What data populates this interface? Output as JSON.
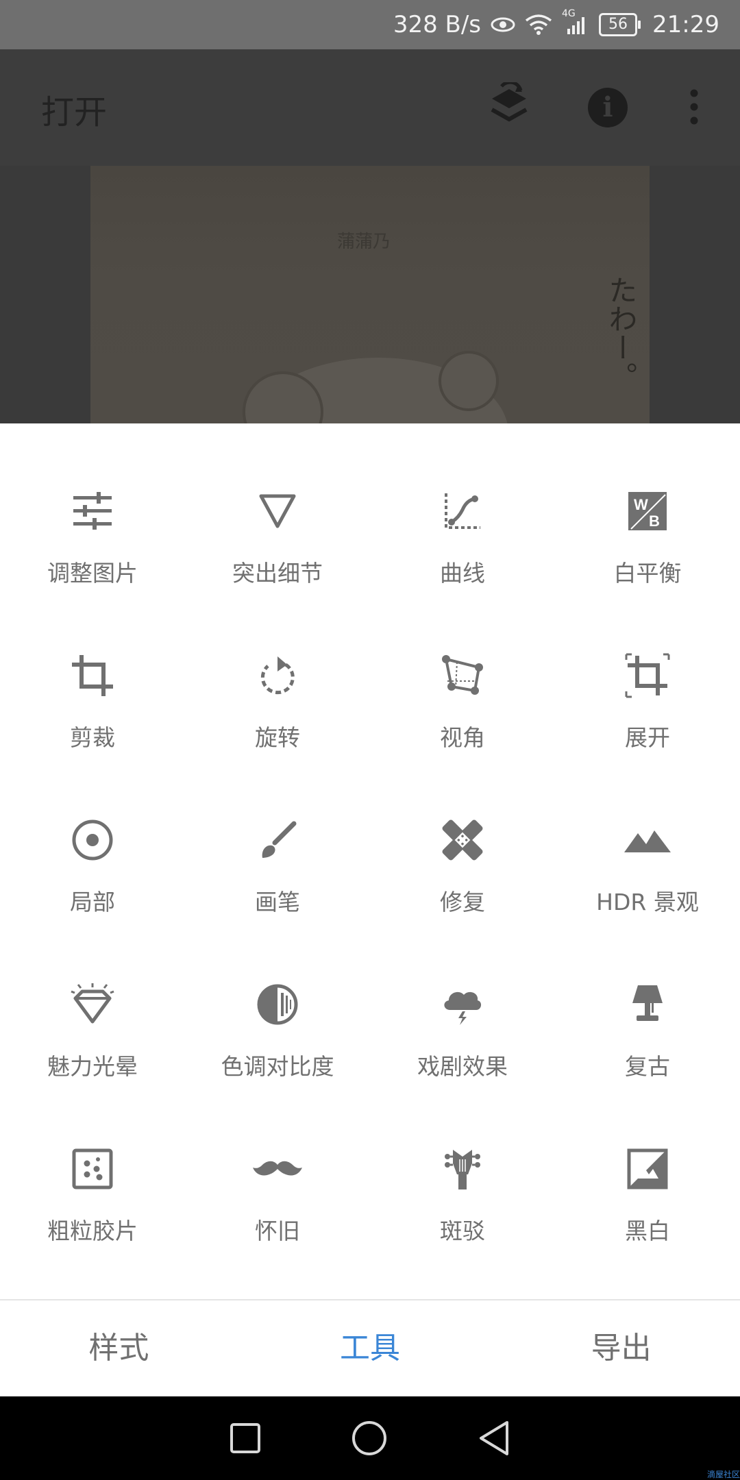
{
  "status_bar": {
    "speed": "328 B/s",
    "network": "4G",
    "battery": "56",
    "time": "21:29"
  },
  "app_bar": {
    "open_label": "打开"
  },
  "photo": {
    "caption": "蒲蒲乃",
    "side_text": "たわー。"
  },
  "tools": [
    {
      "label": "调整图片",
      "icon": "tune-sliders-icon"
    },
    {
      "label": "突出细节",
      "icon": "details-triangle-icon"
    },
    {
      "label": "曲线",
      "icon": "curves-icon"
    },
    {
      "label": "白平衡",
      "icon": "white-balance-icon"
    },
    {
      "label": "剪裁",
      "icon": "crop-icon"
    },
    {
      "label": "旋转",
      "icon": "rotate-icon"
    },
    {
      "label": "视角",
      "icon": "perspective-icon"
    },
    {
      "label": "展开",
      "icon": "expand-icon"
    },
    {
      "label": "局部",
      "icon": "selective-icon"
    },
    {
      "label": "画笔",
      "icon": "brush-icon"
    },
    {
      "label": "修复",
      "icon": "healing-bandage-icon"
    },
    {
      "label": "HDR 景观",
      "icon": "hdr-mountain-icon"
    },
    {
      "label": "魅力光晕",
      "icon": "glamour-diamond-icon"
    },
    {
      "label": "色调对比度",
      "icon": "tonal-contrast-icon"
    },
    {
      "label": "戏剧效果",
      "icon": "drama-cloud-icon"
    },
    {
      "label": "复古",
      "icon": "vintage-lamp-icon"
    },
    {
      "label": "粗粒胶片",
      "icon": "grainy-film-icon"
    },
    {
      "label": "怀旧",
      "icon": "retrolux-mustache-icon"
    },
    {
      "label": "斑驳",
      "icon": "grunge-guitar-icon"
    },
    {
      "label": "黑白",
      "icon": "black-white-icon"
    }
  ],
  "tabs": [
    {
      "label": "样式",
      "active": false
    },
    {
      "label": "工具",
      "active": true
    },
    {
      "label": "导出",
      "active": false
    }
  ],
  "colors": {
    "accent": "#3b86d6",
    "icon": "#707070",
    "label": "#707070"
  },
  "watermark": "滴屋社区"
}
